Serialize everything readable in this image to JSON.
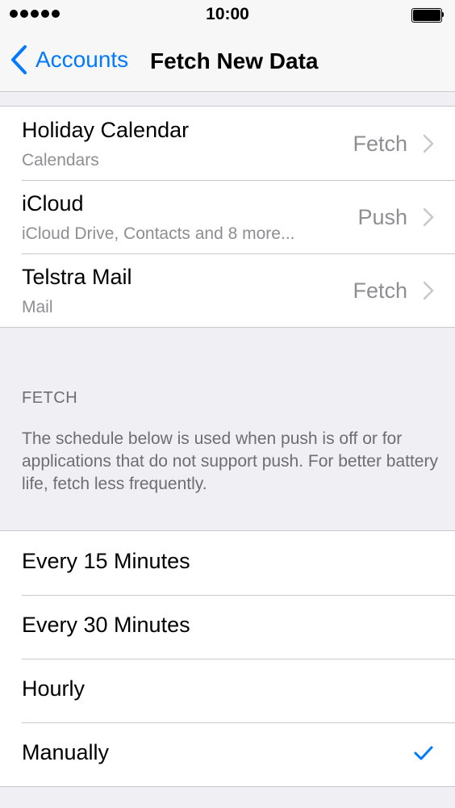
{
  "status_bar": {
    "time": "10:00",
    "signal_icon": "signal-dots-icon",
    "battery_icon": "battery-full-icon"
  },
  "nav": {
    "back_label": "Accounts",
    "back_icon": "chevron-left-icon",
    "title": "Fetch New Data"
  },
  "accounts": [
    {
      "name": "Holiday Calendar",
      "subtitle": "Calendars",
      "value": "Fetch"
    },
    {
      "name": "iCloud",
      "subtitle": "iCloud Drive, Contacts and 8 more...",
      "value": "Push"
    },
    {
      "name": "Telstra Mail",
      "subtitle": "Mail",
      "value": "Fetch"
    }
  ],
  "fetch_section": {
    "header": "FETCH",
    "footer": "The schedule below is used when push is off or for applications that do not support push. For better battery life, fetch less frequently."
  },
  "fetch_options": [
    {
      "label": "Every 15 Minutes"
    },
    {
      "label": "Every 30 Minutes"
    },
    {
      "label": "Hourly"
    },
    {
      "label": "Manually"
    }
  ],
  "selected_option": "Manually",
  "colors": {
    "accent": "#007aff",
    "background": "#efeff4",
    "secondary_text": "#8e8e93",
    "separator": "#c8c7cc"
  }
}
